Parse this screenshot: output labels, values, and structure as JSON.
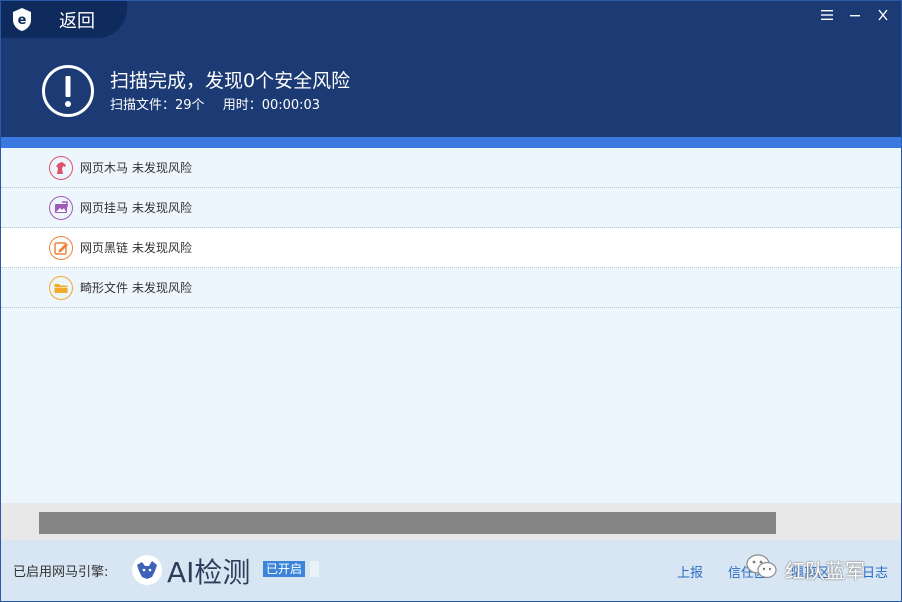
{
  "window": {
    "back_label": "返回",
    "logo_icon": "browser-e-shield-icon",
    "controls": [
      "menu-icon",
      "minimize-icon",
      "close-icon"
    ]
  },
  "result": {
    "title": "扫描完成，发现0个安全风险",
    "scanned_files": "扫描文件：29个",
    "elapsed": "用时：00:00:03",
    "icon": "exclamation-circle-icon"
  },
  "items": [
    {
      "name": "网页木马",
      "status": "未发现风险",
      "icon": "horse-icon",
      "color": "#e0506a",
      "highlighted": false
    },
    {
      "name": "网页挂马",
      "status": "未发现风险",
      "icon": "picture-icon",
      "color": "#a05ab5",
      "highlighted": false
    },
    {
      "name": "网页黑链",
      "status": "未发现风险",
      "icon": "edit-link-icon",
      "color": "#f0823a",
      "highlighted": true
    },
    {
      "name": "畸形文件",
      "status": "未发现风险",
      "icon": "folder-icon",
      "color": "#f3a92a",
      "highlighted": false
    }
  ],
  "progress": {
    "value": 1.0
  },
  "footer": {
    "engine_label": "已启用网马引擎:",
    "engine_icon": "wolf-icon",
    "engine_name": "AI检测",
    "engine_status": "已开启",
    "links": {
      "report": "上报",
      "trust": "信任区",
      "isolation": "隔离区",
      "log": "日志"
    }
  },
  "watermark": {
    "text": "红队蓝军",
    "icon": "wechat-icon"
  },
  "colors": {
    "header_bg": "#1c3a73",
    "accent_bar": "#3a7ae0",
    "list_bg": "#eef6fd",
    "link": "#2a6dc4",
    "badge": "#3b84d8"
  }
}
